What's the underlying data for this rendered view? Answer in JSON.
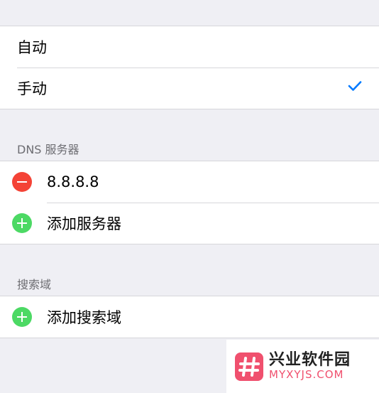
{
  "mode_group": {
    "items": [
      {
        "label": "自动",
        "checked": false
      },
      {
        "label": "手动",
        "checked": true
      }
    ]
  },
  "dns_section": {
    "header": "DNS 服务器",
    "servers": [
      "8.8.8.8"
    ],
    "add_label": "添加服务器"
  },
  "search_section": {
    "header": "搜索域",
    "add_label": "添加搜索域"
  },
  "watermark": {
    "cn": "兴业软件园",
    "en": "MYXYJS.COM"
  },
  "colors": {
    "accent": "#007aff",
    "delete": "#f44336",
    "add": "#4cd964",
    "background": "#efeff4"
  }
}
